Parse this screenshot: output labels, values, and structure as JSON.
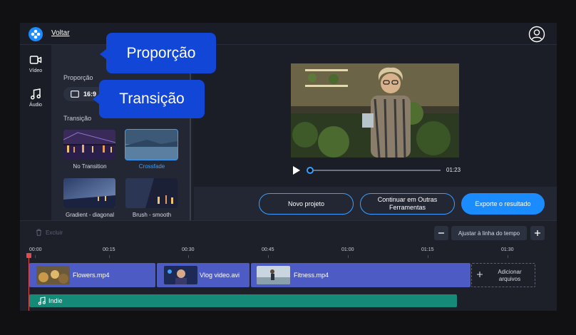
{
  "topbar": {
    "back_label": "Voltar"
  },
  "nav": [
    {
      "label": "Vídeo",
      "icon": "video-camera-icon"
    },
    {
      "label": "Áudio",
      "icon": "music-note-icon"
    }
  ],
  "panel": {
    "ratio_label": "Proporção",
    "ratio_value": "16:9",
    "transition_label": "Transição",
    "transitions": [
      {
        "label": "No Transition",
        "selected": false
      },
      {
        "label": "Crossfade",
        "selected": true
      },
      {
        "label": "Gradient - diagonal",
        "selected": false
      },
      {
        "label": "Brush - smooth",
        "selected": false
      }
    ]
  },
  "callouts": {
    "ratio": "Proporção",
    "transition": "Transição"
  },
  "player": {
    "duration": "01:23"
  },
  "actions": {
    "new_project": "Novo projeto",
    "continue_other": "Continuar em Outras Ferramentas",
    "export": "Exporte o resultado"
  },
  "timeline": {
    "delete_label": "Excluir",
    "fit_label": "Ajustar à linha do tempo",
    "ticks": [
      "00:00",
      "00:15",
      "00:30",
      "00:45",
      "01:00",
      "01:15",
      "01:30"
    ],
    "clips": [
      "Flowers.mp4",
      "Vlog video.avi",
      "Fitness.mp4"
    ],
    "add_files": "Adicionar arquivos",
    "audio": "Indie"
  },
  "colors": {
    "accent": "#1a8cff",
    "callout": "#1246d6",
    "clip": "#4d5cc4",
    "audio": "#168a78",
    "playhead": "#e24b4b"
  }
}
